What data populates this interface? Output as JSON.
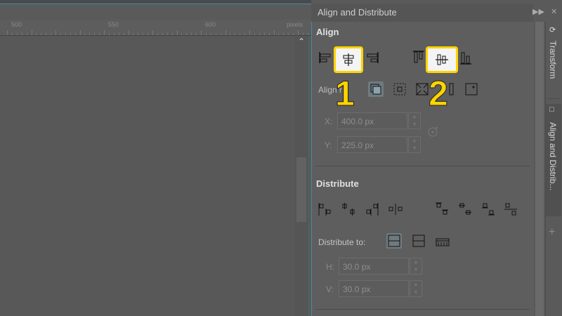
{
  "ruler": {
    "labels": [
      "500",
      "550",
      "600"
    ],
    "units": "pixels"
  },
  "panel": {
    "title": "Align and Distribute"
  },
  "align": {
    "section_title": "Align",
    "relative_label": "Align r",
    "x_label": "X:",
    "x_value": "400.0 px",
    "y_label": "Y:",
    "y_value": "225.0 px"
  },
  "distribute": {
    "section_title": "Distribute",
    "to_label": "Distribute to:",
    "h_label": "H:",
    "h_value": "30.0 px",
    "v_label": "V:",
    "v_value": "30.0 px"
  },
  "callouts": {
    "one": "1",
    "two": "2"
  },
  "side_tabs": {
    "transform": "Transform",
    "align": "Align and Distrib..."
  },
  "colors": {
    "highlight": "#ffd400",
    "accent": "#3b8fb0"
  }
}
